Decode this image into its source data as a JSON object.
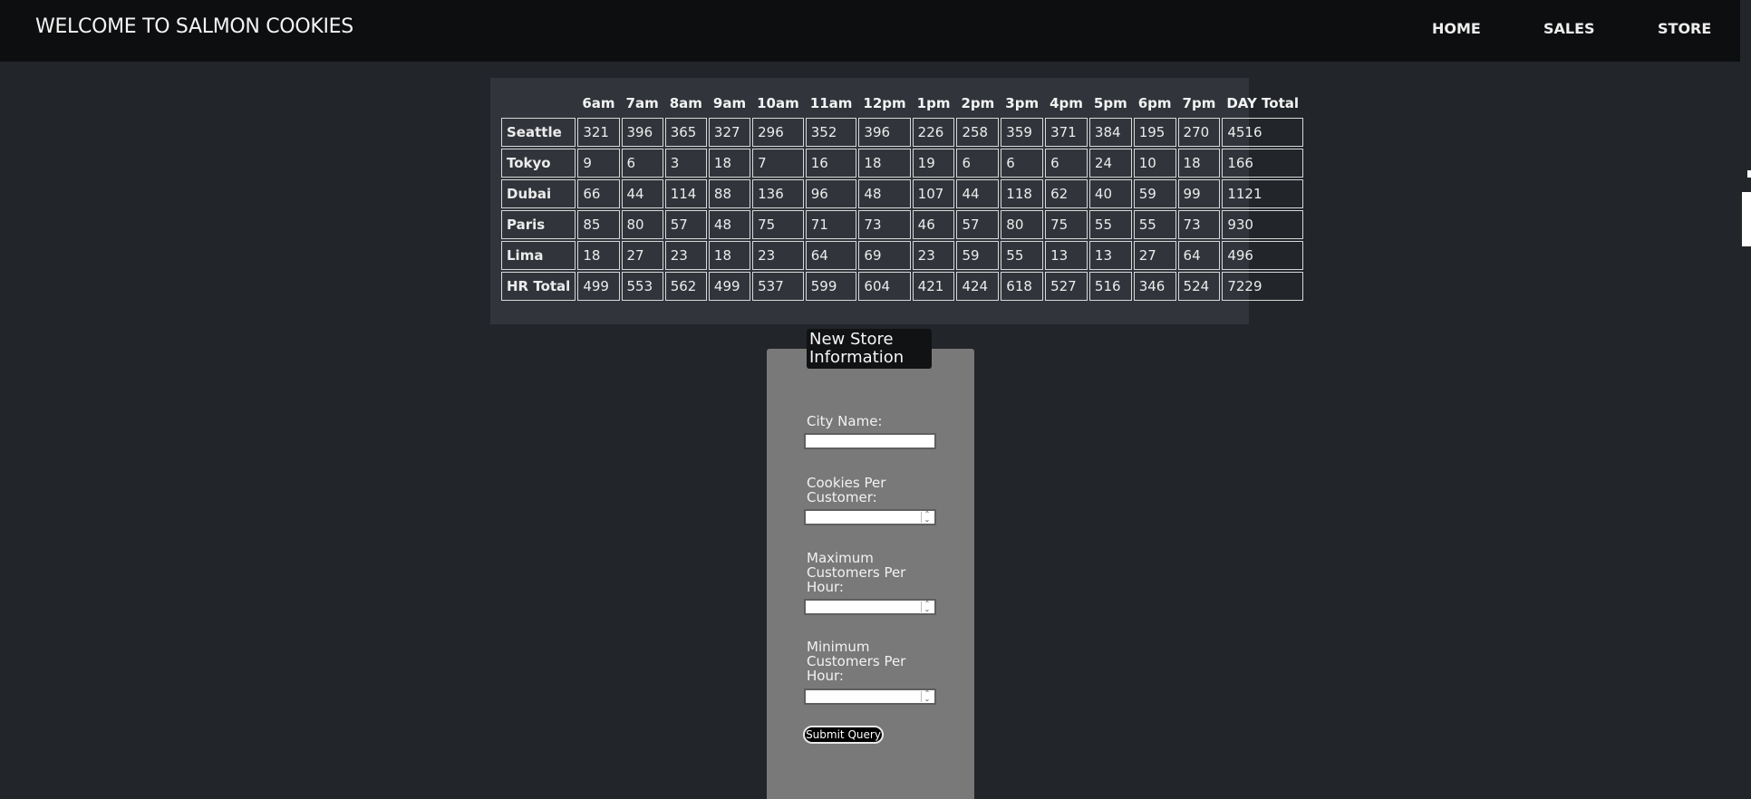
{
  "header": {
    "title": "WELCOME TO SALMON COOKIES",
    "nav": [
      "HOME",
      "SALES",
      "STORE"
    ]
  },
  "sales_table": {
    "columns": [
      "6am",
      "7am",
      "8am",
      "9am",
      "10am",
      "11am",
      "12pm",
      "1pm",
      "2pm",
      "3pm",
      "4pm",
      "5pm",
      "6pm",
      "7pm",
      "DAY Total"
    ],
    "rows": [
      {
        "city": "Seattle",
        "values": [
          "321",
          "396",
          "365",
          "327",
          "296",
          "352",
          "396",
          "226",
          "258",
          "359",
          "371",
          "384",
          "195",
          "270",
          "4516"
        ]
      },
      {
        "city": "Tokyo",
        "values": [
          "9",
          "6",
          "3",
          "18",
          "7",
          "16",
          "18",
          "19",
          "6",
          "6",
          "6",
          "24",
          "10",
          "18",
          "166"
        ]
      },
      {
        "city": "Dubai",
        "values": [
          "66",
          "44",
          "114",
          "88",
          "136",
          "96",
          "48",
          "107",
          "44",
          "118",
          "62",
          "40",
          "59",
          "99",
          "1121"
        ]
      },
      {
        "city": "Paris",
        "values": [
          "85",
          "80",
          "57",
          "48",
          "75",
          "71",
          "73",
          "46",
          "57",
          "80",
          "75",
          "55",
          "55",
          "73",
          "930"
        ]
      },
      {
        "city": "Lima",
        "values": [
          "18",
          "27",
          "23",
          "18",
          "23",
          "64",
          "69",
          "23",
          "59",
          "55",
          "13",
          "13",
          "27",
          "64",
          "496"
        ]
      }
    ],
    "total_row": {
      "label": "HR Total",
      "values": [
        "499",
        "553",
        "562",
        "499",
        "537",
        "599",
        "604",
        "421",
        "424",
        "618",
        "527",
        "516",
        "346",
        "524",
        "7229"
      ]
    }
  },
  "form": {
    "legend": "New Store Information",
    "city_label": "City Name:",
    "cookies_label": "Cookies Per Customer:",
    "max_label": "Maximum Customers Per Hour:",
    "min_label": "Minimum Customers Per Hour:",
    "submit_label": "Submit Query"
  }
}
